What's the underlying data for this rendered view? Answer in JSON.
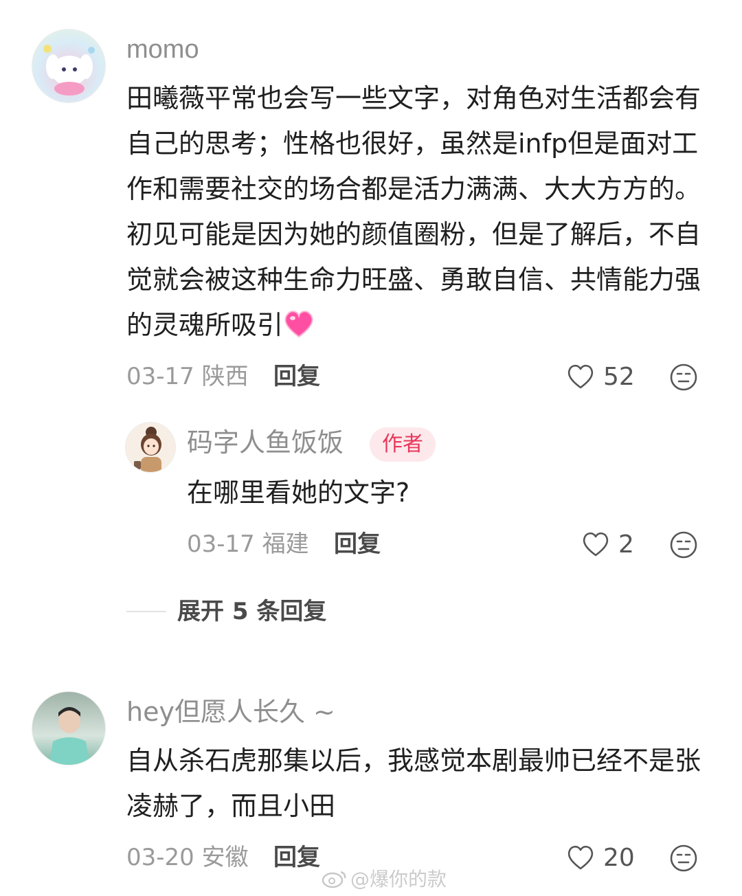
{
  "comments": [
    {
      "username": "momo",
      "text": "田曦薇平常也会写一些文字，对角色对生活都会有自己的思考；性格也很好，虽然是infp但是面对工作和需要社交的场合都是活力满满、大大方方的。初见可能是因为她的颜值圈粉，但是了解后，不自觉就会被这种生命力旺盛、勇敢自信、共情能力强的灵魂所吸引",
      "date_location": "03-17 陕西",
      "reply_label": "回复",
      "likes": "52",
      "emoji": "pink-heart",
      "avatar_icon": "cartoon-puppy-avatar"
    },
    {
      "username": "码字人鱼饭饭",
      "badge": "作者",
      "text": "在哪里看她的文字?",
      "date_location": "03-17 福建",
      "reply_label": "回复",
      "likes": "2",
      "avatar_icon": "cartoon-girl-avatar"
    },
    {
      "username": "hey但愿人长久 ~",
      "text": "自从杀石虎那集以后，我感觉本剧最帅已经不是张凌赫了，而且小田",
      "date_location": "03-20 安徽",
      "reply_label": "回复",
      "likes": "20",
      "avatar_icon": "person-photo-avatar"
    }
  ],
  "expand_replies": "展开 5 条回复",
  "watermark": "@爆你的款",
  "colors": {
    "badge_bg": "#fde8ec",
    "badge_text": "#e8375a",
    "heart_emoji": "#ff4fa3"
  }
}
